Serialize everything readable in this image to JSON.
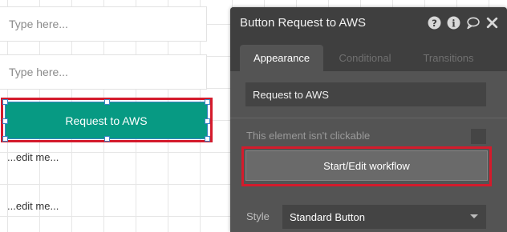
{
  "canvas": {
    "input_1_placeholder": "Type here...",
    "input_2_placeholder": "Type here...",
    "button_label": "Request to AWS",
    "edit_text_1": "...edit me...",
    "edit_text_2": "...edit me..."
  },
  "panel": {
    "title": "Button Request to AWS",
    "header_icons": [
      "help-icon",
      "info-icon",
      "comment-icon",
      "close-icon"
    ],
    "tabs": [
      {
        "label": "Appearance",
        "active": true
      },
      {
        "label": "Conditional",
        "active": false
      },
      {
        "label": "Transitions",
        "active": false
      }
    ],
    "element_name": "Request to AWS",
    "not_clickable_label": "This element isn't clickable",
    "workflow_button": "Start/Edit workflow",
    "style_label": "Style",
    "style_value": "Standard Button"
  },
  "colors": {
    "button_teal": "#079a83",
    "highlight_red": "#d41b2c",
    "selection_blue": "#3b82c4",
    "panel_bg": "#545454",
    "panel_header": "#3f3f3f"
  }
}
